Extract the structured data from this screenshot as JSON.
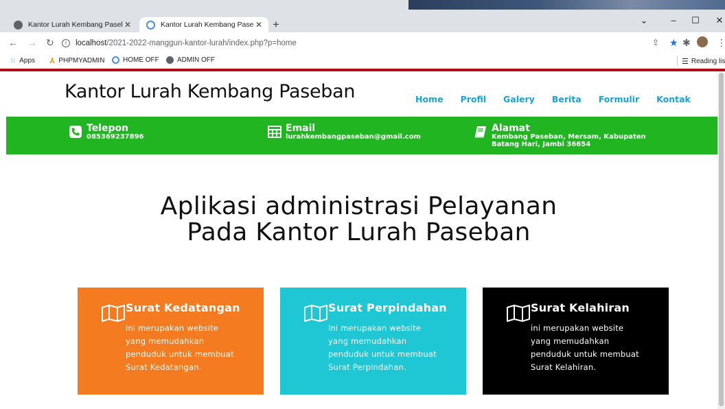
{
  "browser": {
    "tabs": [
      {
        "title": "Kantor Lurah Kembang Paseban",
        "active": false
      },
      {
        "title": "Kantor Lurah Kembang Paseban",
        "active": true
      }
    ],
    "address": {
      "host": "localhost",
      "path": "/2021-2022-manggun-kantor-lurah/index.php?p=home"
    },
    "bookmarks": [
      "Apps",
      "PHPMYADMIN",
      "HOME OFF",
      "ADMIN OFF"
    ],
    "reading_list": "Reading list"
  },
  "site": {
    "title": "Kantor Lurah Kembang Paseban",
    "nav": [
      "Home",
      "Profil",
      "Galery",
      "Berita",
      "Formulir",
      "Kontak"
    ],
    "nav_color": "#1aa1d6",
    "accent_green": "#22b522",
    "contacts": {
      "phone": {
        "label": "Telepon",
        "value": "085369237896"
      },
      "email": {
        "label": "Email",
        "value": "lurahkembangpaseban@gmail.com"
      },
      "address": {
        "label": "Alamat",
        "line1": "Kembang Paseban, Mersam, Kabupaten",
        "line2": "Batang Hari, Jambi 36654"
      }
    },
    "hero": {
      "line1": "Aplikasi administrasi Pelayanan",
      "line2": "Pada Kantor Lurah Paseban"
    },
    "cards": [
      {
        "title": "Surat Kedatangan",
        "lines": [
          "ini merupakan website",
          "yang memudahkan",
          "penduduk untuk membuat",
          "Surat Kedatangan."
        ],
        "color": "#f47b20"
      },
      {
        "title": "Surat Perpindahan",
        "lines": [
          "ini merupakan website",
          "yang memudahkan",
          "penduduk untuk membuat",
          "Surat Perpindahan."
        ],
        "color": "#1fc7d4"
      },
      {
        "title": "Surat Kelahiran",
        "lines": [
          "ini merupakan website",
          "yang memudahkan",
          "penduduk untuk membuat",
          "Surat Kelahiran."
        ],
        "color": "#000000"
      }
    ]
  }
}
